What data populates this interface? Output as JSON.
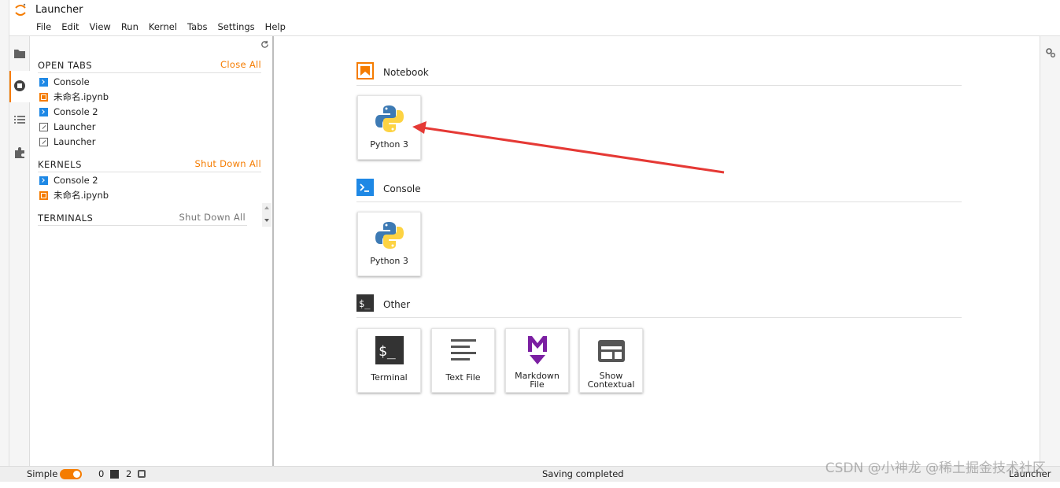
{
  "app": {
    "title": "Launcher"
  },
  "menu": [
    "File",
    "Edit",
    "View",
    "Run",
    "Kernel",
    "Tabs",
    "Settings",
    "Help"
  ],
  "sidebar": {
    "open_tabs": {
      "title": "OPEN TABS",
      "action": "Close All",
      "items": [
        {
          "label": "Console",
          "icon": "console-icon"
        },
        {
          "label": "未命名.ipynb",
          "icon": "notebook-icon"
        },
        {
          "label": "Console 2",
          "icon": "console-icon"
        },
        {
          "label": "Launcher",
          "icon": "launcher-icon"
        },
        {
          "label": "Launcher",
          "icon": "launcher-icon"
        }
      ]
    },
    "kernels": {
      "title": "KERNELS",
      "action": "Shut Down All",
      "items": [
        {
          "label": "Console 2",
          "icon": "console-icon"
        },
        {
          "label": "未命名.ipynb",
          "icon": "notebook-icon"
        }
      ]
    },
    "terminals": {
      "title": "TERMINALS",
      "action": "Shut Down All"
    }
  },
  "launcher": {
    "notebook": {
      "title": "Notebook",
      "cards": [
        {
          "label": "Python 3",
          "icon": "python-icon"
        }
      ]
    },
    "console": {
      "title": "Console",
      "cards": [
        {
          "label": "Python 3",
          "icon": "python-icon"
        }
      ]
    },
    "other": {
      "title": "Other",
      "cards": [
        {
          "label": "Terminal",
          "icon": "terminal-icon"
        },
        {
          "label": "Text File",
          "icon": "text-file-icon"
        },
        {
          "label": "Markdown File",
          "label_line1": "Markdown",
          "label_line2": "File",
          "icon": "markdown-icon"
        },
        {
          "label": "Show Contextual",
          "label_line1": "Show",
          "label_line2": "Contextual",
          "icon": "contextual-help-icon"
        }
      ]
    }
  },
  "status": {
    "mode_label": "Simple",
    "terminals_count": "0",
    "kernels_count": "2",
    "message": "Saving completed",
    "active": "Launcher"
  },
  "watermark": "CSDN @小神龙 @稀土掘金技术社区",
  "colors": {
    "accent": "#f57c00",
    "console": "#1e88e5",
    "arrow": "#e53935"
  }
}
